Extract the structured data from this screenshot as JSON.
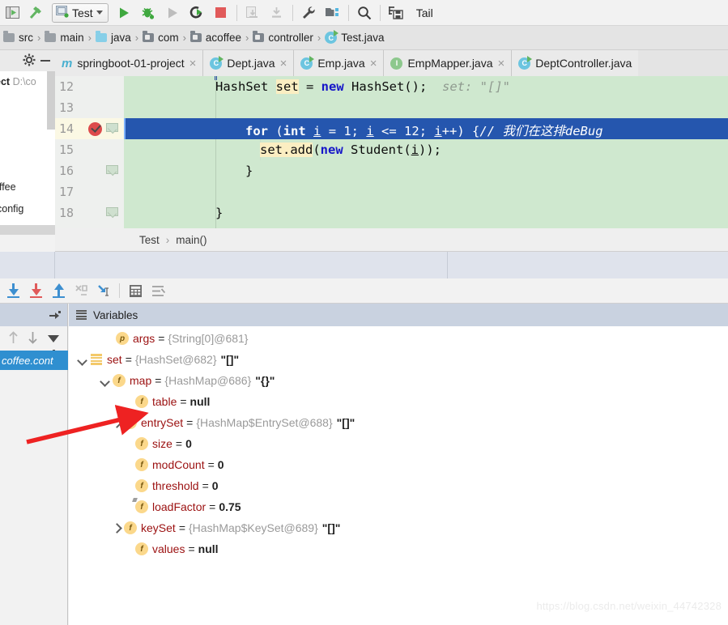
{
  "toolbar": {
    "icons": [
      "project-toggle-icon",
      "build-hammer-icon"
    ],
    "run_config": {
      "name": "Test",
      "icon": "run-config-icon",
      "chevron": "chevron-down-icon"
    },
    "buttons": [
      {
        "name": "run-button",
        "icon": "play-icon"
      },
      {
        "name": "debug-button",
        "icon": "bug-icon"
      },
      {
        "name": "run-with-coverage-button",
        "icon": "play-disabled-icon"
      },
      {
        "name": "rerun-button",
        "icon": "rerun-icon"
      },
      {
        "name": "stop-button",
        "icon": "stop-square-icon"
      },
      {
        "name": "update-app-button",
        "icon": "update-disabled-icon"
      },
      {
        "name": "install-button",
        "icon": "install-disabled-icon"
      },
      {
        "name": "settings-button",
        "icon": "wrench-icon"
      },
      {
        "name": "project-structure-button",
        "icon": "project-structure-icon"
      },
      {
        "name": "search-everywhere-button",
        "icon": "search-icon"
      },
      {
        "name": "save-all-button",
        "icon": "save-all-icon"
      }
    ],
    "tail_label": "Tail"
  },
  "breadcrumb": {
    "items": [
      {
        "label": "src",
        "icon": "folder-icon"
      },
      {
        "label": "main",
        "icon": "folder-icon"
      },
      {
        "label": "java",
        "icon": "folder-blue-icon"
      },
      {
        "label": "com",
        "icon": "folder-dark-icon"
      },
      {
        "label": "acoffee",
        "icon": "folder-dark-icon"
      },
      {
        "label": "controller",
        "icon": "folder-dark-icon"
      },
      {
        "label": "Test.java",
        "icon": "java-class-icon"
      }
    ],
    "separator": "›"
  },
  "left_panel": {
    "gear_icon": "gear-icon",
    "minimize_icon": "minimize-icon",
    "tree_rows": [
      {
        "label": "ect",
        "path": "D:\\co"
      },
      {
        "label": "offee"
      },
      {
        "label": "config"
      }
    ]
  },
  "editor": {
    "line_numbers": [
      "12",
      "13",
      "14",
      "15",
      "16",
      "17",
      "18"
    ],
    "breakpoint_line": "14",
    "breakpoint_icon": "breakpoint-verified-icon",
    "lines": [
      {
        "num": "12",
        "text": "HashSet set = new HashSet();",
        "hint": "set: \"[]\""
      },
      {
        "num": "13",
        "text": ""
      },
      {
        "num": "14",
        "text": "for (int i = 1; i <= 12; i++) {",
        "comment": "// 我们在这排deBug",
        "current": true
      },
      {
        "num": "15",
        "text": "set.add(new Student(i));"
      },
      {
        "num": "16",
        "text": "}"
      },
      {
        "num": "17",
        "text": ""
      },
      {
        "num": "18",
        "text": "}"
      }
    ],
    "footer_breadcrumb": [
      "Test",
      "main()"
    ],
    "footer_separator": "›"
  },
  "debug_toolbar": {
    "buttons": [
      {
        "name": "step-over-button",
        "icon": "step-over-icon"
      },
      {
        "name": "step-into-button",
        "icon": "step-into-icon"
      },
      {
        "name": "step-out-button",
        "icon": "step-out-icon"
      },
      {
        "name": "force-step-into-button",
        "icon": "force-step-into-icon"
      },
      {
        "name": "run-to-cursor-button",
        "icon": "run-to-cursor-icon"
      },
      {
        "name": "evaluate-expression-button",
        "icon": "calculator-icon"
      },
      {
        "name": "mute-breakpoints-button",
        "icon": "mute-breakpoints-icon"
      }
    ]
  },
  "frames_panel": {
    "pin_icon": "pin-tab-icon",
    "tools": [
      {
        "name": "frame-up-button",
        "icon": "arrow-up-icon"
      },
      {
        "name": "frame-down-button",
        "icon": "arrow-down-icon"
      },
      {
        "name": "filter-frames-button",
        "icon": "funnel-icon"
      }
    ],
    "selected_frame": "coffee.cont"
  },
  "variables": {
    "title": "Variables",
    "title_icon": "variables-list-icon",
    "rows": [
      {
        "indent": 0,
        "twist": "none",
        "icon": "p",
        "icon_kind": "param",
        "name": "args",
        "eq": "=",
        "ref": "{String[0]@681}",
        "value": ""
      },
      {
        "indent": 0,
        "twist": "down",
        "icon": "list",
        "icon_kind": "collection",
        "name": "set",
        "eq": "=",
        "ref": "{HashSet@682}",
        "value": "\"[]\""
      },
      {
        "indent": 1,
        "twist": "down",
        "icon": "f",
        "icon_kind": "field",
        "name": "map",
        "eq": "=",
        "ref": "{HashMap@686}",
        "value": "\"{}\""
      },
      {
        "indent": 2,
        "twist": "none",
        "icon": "f",
        "icon_kind": "field",
        "name": "table",
        "eq": "=",
        "ref": "",
        "value": "null"
      },
      {
        "indent": 2,
        "twist": "right",
        "icon": "f",
        "icon_kind": "field",
        "name": "entrySet",
        "eq": "=",
        "ref": "{HashMap$EntrySet@688}",
        "value": "\"[]\""
      },
      {
        "indent": 2,
        "twist": "none",
        "icon": "f",
        "icon_kind": "field",
        "name": "size",
        "eq": "=",
        "ref": "",
        "value": "0"
      },
      {
        "indent": 2,
        "twist": "none",
        "icon": "f",
        "icon_kind": "field",
        "name": "modCount",
        "eq": "=",
        "ref": "",
        "value": "0"
      },
      {
        "indent": 2,
        "twist": "none",
        "icon": "f",
        "icon_kind": "field",
        "name": "threshold",
        "eq": "=",
        "ref": "",
        "value": "0"
      },
      {
        "indent": 2,
        "twist": "none",
        "icon": "f",
        "icon_kind": "field-final",
        "name": "loadFactor",
        "eq": "=",
        "ref": "",
        "value": "0.75"
      },
      {
        "indent": 2,
        "twist": "right",
        "icon": "f",
        "icon_kind": "field",
        "name": "keySet",
        "eq": "=",
        "ref": "{HashMap$KeySet@689}",
        "value": "\"[]\""
      },
      {
        "indent": 2,
        "twist": "none",
        "icon": "f",
        "icon_kind": "field",
        "name": "values",
        "eq": "=",
        "ref": "",
        "value": "null"
      }
    ]
  },
  "editor_tabs": [
    {
      "label": "springboot-01-project",
      "icon": "maven-module-icon",
      "icon_letter": "m",
      "close": "×",
      "active": false
    },
    {
      "label": "Dept.java",
      "icon": "java-class-icon",
      "icon_letter": "C",
      "close": "×",
      "active": false
    },
    {
      "label": "Emp.java",
      "icon": "java-class-icon",
      "icon_letter": "C",
      "close": "×",
      "active": false
    },
    {
      "label": "EmpMapper.java",
      "icon": "java-interface-icon",
      "icon_letter": "I",
      "close": "×",
      "active": false
    },
    {
      "label": "DeptController.java",
      "icon": "java-class-icon",
      "icon_letter": "C",
      "close": "",
      "active": false
    }
  ],
  "annotation": {
    "arrow_icon": "red-arrow-annotation",
    "color": "#ee2222"
  },
  "watermark": "https://blog.csdn.net/weixin_44742328",
  "colors": {
    "editor_background": "#cfe8cf",
    "current_line": "#2556ae",
    "accent": "#2f8fd0",
    "breakpoint": "#dd4b4b",
    "variable_name": "#9b1010",
    "reference": "#9a9a9a"
  }
}
